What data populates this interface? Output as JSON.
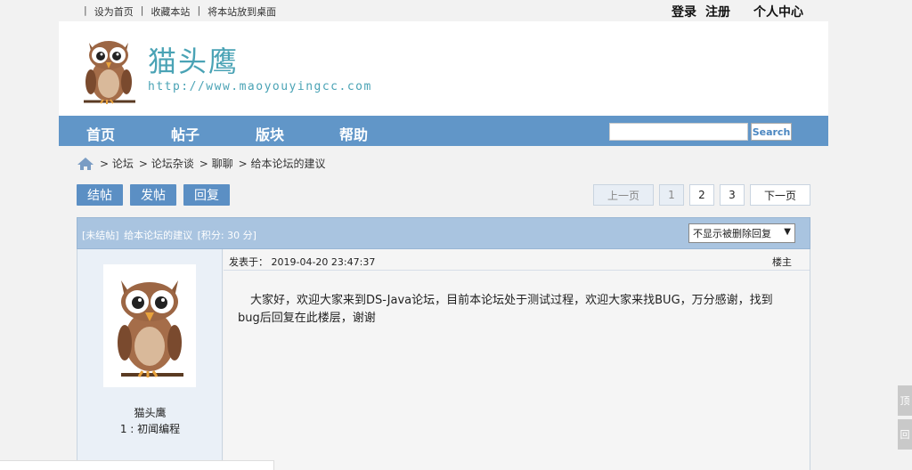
{
  "topbar": {
    "links": [
      "设为首页",
      "收藏本站",
      "将本站放到桌面"
    ],
    "login": "登录",
    "register": "注册",
    "user_center": "个人中心"
  },
  "header": {
    "title": "猫头鹰",
    "url": "http://www.maoyouyingcc.com"
  },
  "nav": {
    "items": [
      "首页",
      "帖子",
      "版块",
      "帮助"
    ],
    "search_value": "",
    "search_label": "Search"
  },
  "breadcrumb": [
    "> 论坛",
    "> 论坛杂谈",
    "> 聊聊",
    ">  给本论坛的建议"
  ],
  "actions": {
    "close_label": "结帖",
    "post_label": "发帖",
    "reply_label": "回复"
  },
  "pager": {
    "prev": "上一页",
    "pages": [
      "1",
      "2",
      "3"
    ],
    "next": "下一页"
  },
  "thread": {
    "status": "[未结帖]",
    "title": "给本论坛的建议",
    "points": "[积分: 30 分]",
    "filter_value": "不显示被删除回复"
  },
  "post": {
    "username": "猫头鹰",
    "level": "1 : 初闻编程",
    "date": "发表于：  2019-04-20 23:47:37",
    "floor": "楼主",
    "content": "大家好，欢迎大家来到DS-Java论坛，目前本论坛处于测试过程，欢迎大家来找BUG，万分感谢，找到bug后回复在此楼层，谢谢"
  },
  "float": {
    "top_label": "顶",
    "second_label": "回"
  },
  "colors": {
    "nav": "#6196c8",
    "title": "#4aa3b5",
    "button": "#5b8fc4",
    "thread_head": "#a9c4e0"
  }
}
